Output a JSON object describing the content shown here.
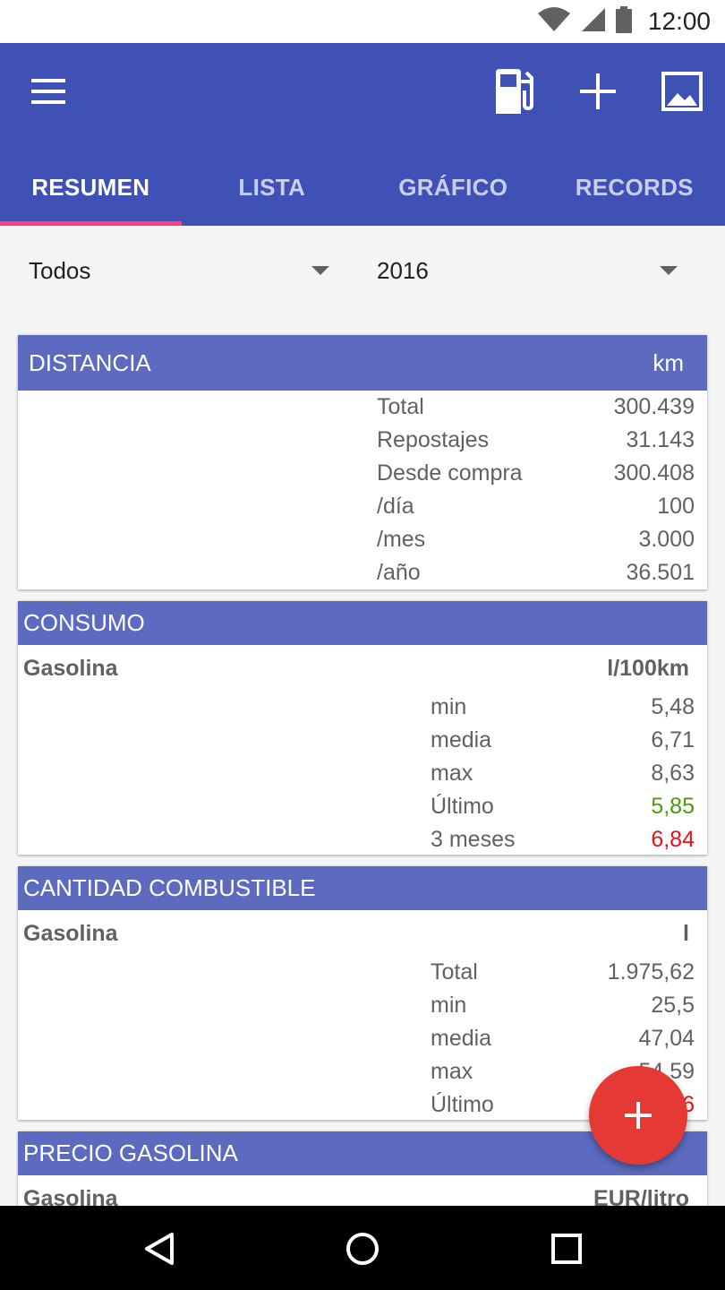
{
  "status_bar": {
    "time": "12:00",
    "icons": [
      "wifi-icon",
      "signal-icon",
      "battery-icon"
    ]
  },
  "app_bar": {
    "icons": [
      "menu-icon",
      "fuel-pump-icon",
      "add-icon",
      "image-icon"
    ],
    "tabs": [
      {
        "label": "RESUMEN",
        "active": true
      },
      {
        "label": "LISTA",
        "active": false
      },
      {
        "label": "GRÁFICO",
        "active": false
      },
      {
        "label": "RECORDS",
        "active": false
      }
    ],
    "accent_color": "#3f51b5",
    "indicator_color": "#ff4081"
  },
  "filters": {
    "vehicle": "Todos",
    "year": "2016"
  },
  "distancia": {
    "title": "DISTANCIA",
    "unit": "km",
    "rows": [
      {
        "label": "Total",
        "value": "300.439"
      },
      {
        "label": "Repostajes",
        "value": "31.143"
      },
      {
        "label": "Desde compra",
        "value": "300.408"
      },
      {
        "label": "/día",
        "value": "100"
      },
      {
        "label": "/mes",
        "value": "3.000"
      },
      {
        "label": "/año",
        "value": "36.501"
      }
    ]
  },
  "consumo": {
    "title": "CONSUMO",
    "fuel": "Gasolina",
    "unit": "l/100km",
    "rows": [
      {
        "label": "min",
        "value": "5,48",
        "color": "#616161"
      },
      {
        "label": "media",
        "value": "6,71",
        "color": "#616161"
      },
      {
        "label": "max",
        "value": "8,63",
        "color": "#616161"
      },
      {
        "label": "Último",
        "value": "5,85",
        "color": "#4c9a0e"
      },
      {
        "label": "3 meses",
        "value": "6,84",
        "color": "#e8101a"
      }
    ]
  },
  "cantidad": {
    "title": "CANTIDAD COMBUSTIBLE",
    "fuel": "Gasolina",
    "unit": "l",
    "rows": [
      {
        "label": "Total",
        "value": "1.975,62",
        "color": "#616161"
      },
      {
        "label": "min",
        "value": "25,5",
        "color": "#616161"
      },
      {
        "label": "media",
        "value": "47,04",
        "color": "#616161"
      },
      {
        "label": "max",
        "value": "54,59",
        "color": "#616161"
      },
      {
        "label": "Último",
        "value": "6",
        "color": "#e8101a"
      }
    ]
  },
  "precio": {
    "title": "PRECIO GASOLINA",
    "fuel": "Gasolina",
    "unit": "EUR/litro"
  },
  "fab": {
    "icon": "add-icon",
    "color": "#e53935"
  },
  "nav_bar": {
    "icons": [
      "back-icon",
      "home-icon",
      "recents-icon"
    ]
  }
}
